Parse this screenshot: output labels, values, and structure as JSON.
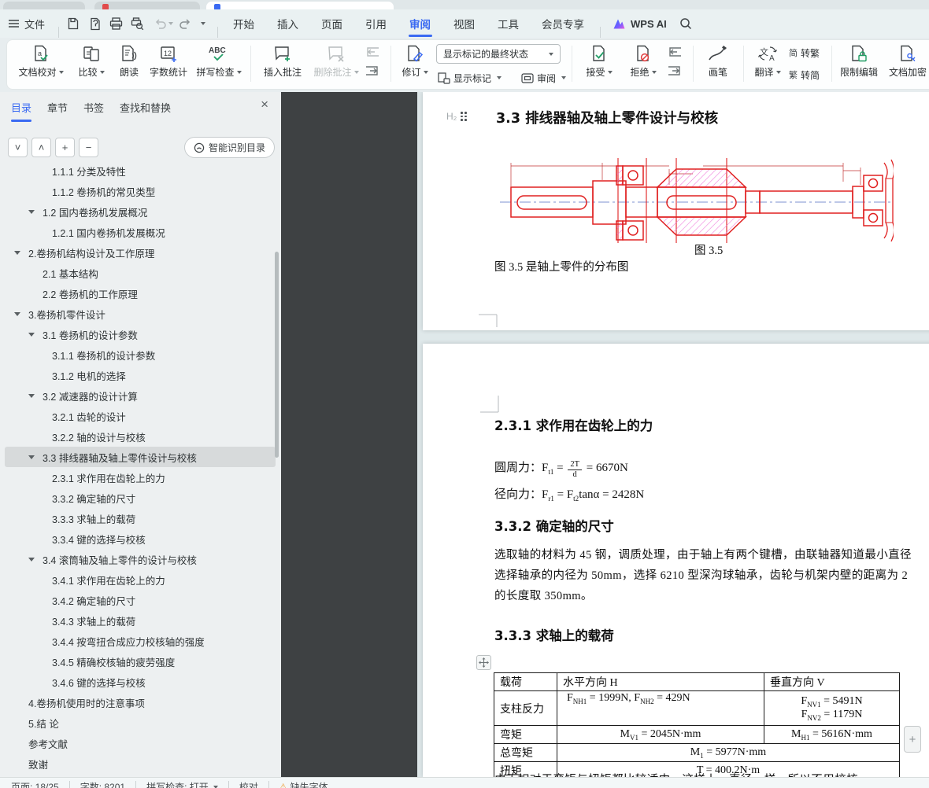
{
  "window": {
    "tab_icons": [
      "plain",
      "red-doc",
      "blue-doc"
    ]
  },
  "menu": {
    "file": "文件",
    "tabs": [
      "开始",
      "插入",
      "页面",
      "引用",
      "审阅",
      "视图",
      "工具",
      "会员专享"
    ],
    "active_index": 4,
    "ai_label": "WPS AI"
  },
  "ribbon": {
    "proofread": "文档校对",
    "compare": "比较",
    "read_aloud": "朗读",
    "word_count": "字数统计",
    "spell_check": "拼写检查",
    "insert_comment": "插入批注",
    "delete_comment": "删除批注",
    "track_changes": "修订",
    "markup_state": "显示标记的最终状态",
    "show_markup": "显示标记",
    "review": "审阅",
    "accept": "接受",
    "reject": "拒绝",
    "pen": "画笔",
    "translate": "翻译",
    "jian": "简",
    "fan": "繁",
    "to_traditional": "转繁",
    "to_simplified": "转简",
    "restrict_edit": "限制编辑",
    "encrypt": "文档加密",
    "clipped_btn": "文"
  },
  "sidebar": {
    "tabs": [
      "目录",
      "章节",
      "书签",
      "查找和替换"
    ],
    "active_tab": "目录",
    "smart_toc": "智能识别目录",
    "toc": [
      {
        "l": "1.1.1 分类及特性",
        "v": 3
      },
      {
        "l": "1.1.2 卷扬机的常见类型",
        "v": 3
      },
      {
        "l": "1.2 国内卷扬机发展概况",
        "v": 2,
        "e": 1
      },
      {
        "l": "1.2.1 国内卷扬机发展概况",
        "v": 3
      },
      {
        "l": "2.卷扬机结构设计及工作原理",
        "v": 1,
        "e": 1
      },
      {
        "l": "2.1 基本结构",
        "v": 2
      },
      {
        "l": "2.2 卷扬机的工作原理",
        "v": 2
      },
      {
        "l": "3.卷扬机零件设计",
        "v": 1,
        "e": 1
      },
      {
        "l": "3.1 卷扬机的设计参数",
        "v": 2,
        "e": 1
      },
      {
        "l": "3.1.1 卷扬机的设计参数",
        "v": 3
      },
      {
        "l": "3.1.2 电机的选择",
        "v": 3
      },
      {
        "l": "3.2 减速器的设计计算",
        "v": 2,
        "e": 1
      },
      {
        "l": "3.2.1 齿轮的设计",
        "v": 3
      },
      {
        "l": "3.2.2 轴的设计与校核",
        "v": 3
      },
      {
        "l": "3.3 排线器轴及轴上零件设计与校核",
        "v": 2,
        "e": 1,
        "s": 1
      },
      {
        "l": "2.3.1 求作用在齿轮上的力",
        "v": 3
      },
      {
        "l": "3.3.2 确定轴的尺寸",
        "v": 3
      },
      {
        "l": "3.3.3 求轴上的载荷",
        "v": 3
      },
      {
        "l": "3.3.4 键的选择与校核",
        "v": 3
      },
      {
        "l": "3.4 滚筒轴及轴上零件的设计与校核",
        "v": 2,
        "e": 1
      },
      {
        "l": "3.4.1 求作用在齿轮上的力",
        "v": 3
      },
      {
        "l": "3.4.2 确定轴的尺寸",
        "v": 3
      },
      {
        "l": "3.4.3 求轴上的载荷",
        "v": 3
      },
      {
        "l": "3.4.4 按弯扭合成应力校核轴的强度",
        "v": 3
      },
      {
        "l": "3.4.5 精确校核轴的疲劳强度",
        "v": 3
      },
      {
        "l": "3.4.6 键的选择与校核",
        "v": 3
      },
      {
        "l": "4.卷扬机使用时的注意事项",
        "v": 1
      },
      {
        "l": "5.结 论",
        "v": 1
      },
      {
        "l": "参考文献",
        "v": 1
      },
      {
        "l": "致谢",
        "v": 1
      }
    ]
  },
  "doc": {
    "page1": {
      "heading_tag": "H₂",
      "heading": "3.3 排线器轴及轴上零件设计与校核",
      "figure_caption": "图 3.5",
      "figure_note": "图 3.5 是轴上零件的分布图"
    },
    "page2": {
      "heading1": "2.3.1 求作用在齿轮上的力",
      "formula1": [
        {
          "t": "圆周力："
        },
        {
          "t": "F"
        },
        {
          "sub": "t1"
        },
        {
          "t": " = "
        },
        {
          "frac": [
            "2T",
            "d"
          ]
        },
        {
          "t": " = 6670N"
        }
      ],
      "formula2": [
        {
          "t": "径向力："
        },
        {
          "t": "F"
        },
        {
          "sub": "r1"
        },
        {
          "t": " = F"
        },
        {
          "sub": "t2"
        },
        {
          "t": "tanα = 2428N"
        }
      ],
      "heading2": "3.3.2 确定轴的尺寸",
      "para": [
        "选取轴的材料为 45 钢，调质处理，由于轴上有两个键槽，由联轴器知道最小直径",
        "选择轴承的内径为 50mm，选择 6210 型深沟球轴承，齿轮与机架内壁的距离为 2",
        "的长度取 350mm。"
      ],
      "heading3": "3.3.3 求轴上的载荷",
      "table": {
        "col_headers": [
          "载荷",
          "水平方向 H",
          "垂直方向 V"
        ],
        "row_labels": [
          "支柱反力",
          "弯矩",
          "总弯矩",
          "扭矩"
        ],
        "r1h": [
          {
            "t": "F"
          },
          {
            "sub": "NH1"
          },
          {
            "t": " = 1999N, F"
          },
          {
            "sub": "NH2"
          },
          {
            "t": " = 429N"
          }
        ],
        "r1v": [
          {
            "t": "F"
          },
          {
            "sub": "NV1"
          },
          {
            "t": " = 5491N"
          },
          {
            "br": true
          },
          {
            "t": "F"
          },
          {
            "sub": "NV2"
          },
          {
            "t": " = 1179N"
          }
        ],
        "r2h": [
          {
            "t": "M"
          },
          {
            "sub": "V1"
          },
          {
            "t": " = 2045N·mm"
          }
        ],
        "r2v": [
          {
            "t": "M"
          },
          {
            "sub": "H1"
          },
          {
            "t": " = 5616N·mm"
          }
        ],
        "r3": [
          {
            "t": "M"
          },
          {
            "sub": "1"
          },
          {
            "t": " = 5977N·mm"
          }
        ],
        "r4": [
          {
            "t": "T = 400.2N·m"
          }
        ]
      },
      "partial_line": "由于相对于弯矩与扭矩都比较适中，这样上，直径一样，所以不用校核"
    }
  },
  "status": {
    "page": "页面: 18/25",
    "words": "字数: 8201",
    "spell": "拼写检查: 打开",
    "proof": "校对",
    "missing_font": "缺失字体"
  },
  "glyphs": {
    "close": "×",
    "down": "˅",
    "up": "˄",
    "plus": "+",
    "minus": "−",
    "warn": "⚠"
  },
  "colors": {
    "accent": "#3a6af2",
    "green": "#26a06a",
    "red": "#e03c3c",
    "drawing_red": "#e02020",
    "hatch": "#ee6fd9",
    "centerline": "#7d90d0"
  }
}
